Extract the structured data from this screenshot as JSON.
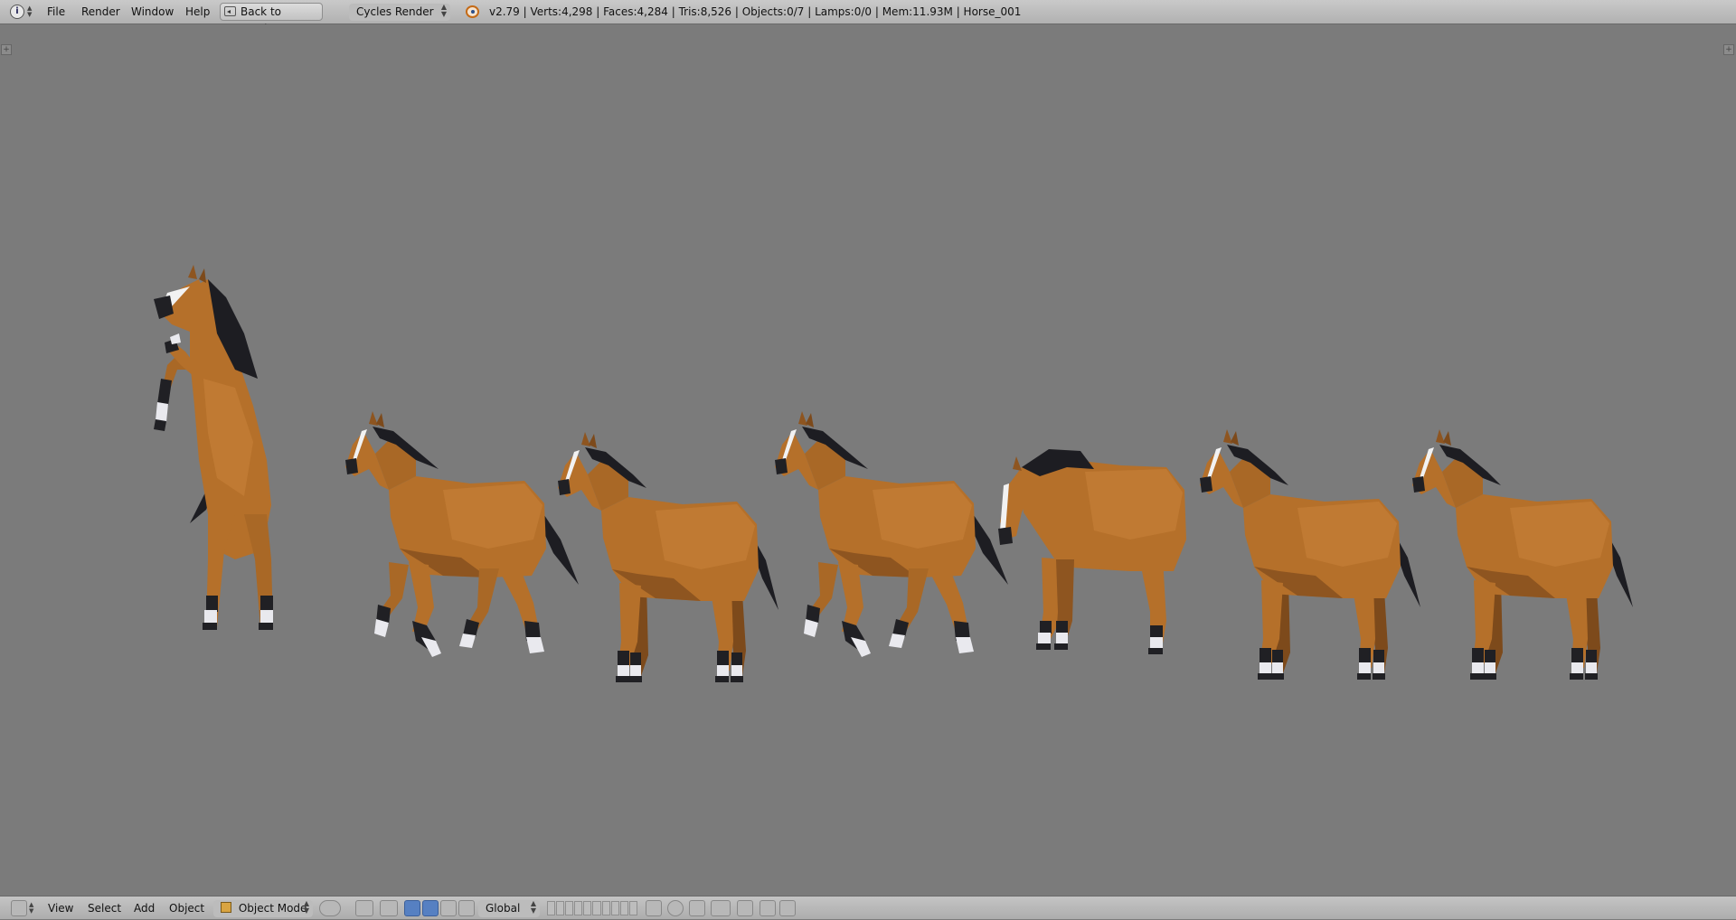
{
  "top_header": {
    "editor_type_icon": "info-icon",
    "menus": [
      "File",
      "Render",
      "Window",
      "Help"
    ],
    "back_button": {
      "label": "Back to Previous",
      "icon": "screen-back-icon"
    },
    "render_engine": "Cycles Render",
    "logo_icon": "blender-logo-icon",
    "stats": "v2.79 | Verts:4,298 | Faces:4,284 | Tris:8,526 | Objects:0/7 | Lamps:0/0 | Mem:11.93M | Horse_001"
  },
  "viewport": {
    "background_color": "#7b7b7b",
    "corner_widgets": [
      "+",
      "+"
    ],
    "horses": [
      {
        "name": "horse-rearing",
        "pose": "rearing"
      },
      {
        "name": "horse-gallop-1",
        "pose": "gallop"
      },
      {
        "name": "horse-trot-1",
        "pose": "trot"
      },
      {
        "name": "horse-gallop-2",
        "pose": "gallop"
      },
      {
        "name": "horse-head-down",
        "pose": "grazing"
      },
      {
        "name": "horse-walk",
        "pose": "walk"
      },
      {
        "name": "horse-standing",
        "pose": "stand"
      }
    ],
    "horse_colors": {
      "body": "#b5702a",
      "body_shade": "#8e5520",
      "mane": "#1d1d22",
      "sock": "#e9e9ee",
      "hoof": "#202024",
      "blaze": "#f2f2f2"
    }
  },
  "bottom_header": {
    "editor_type_icon": "3d-view-icon",
    "menus": [
      "View",
      "Select",
      "Add",
      "Object"
    ],
    "mode": "Object Mode",
    "transform_orientation": "Global",
    "accent_color": "#5680c2"
  }
}
